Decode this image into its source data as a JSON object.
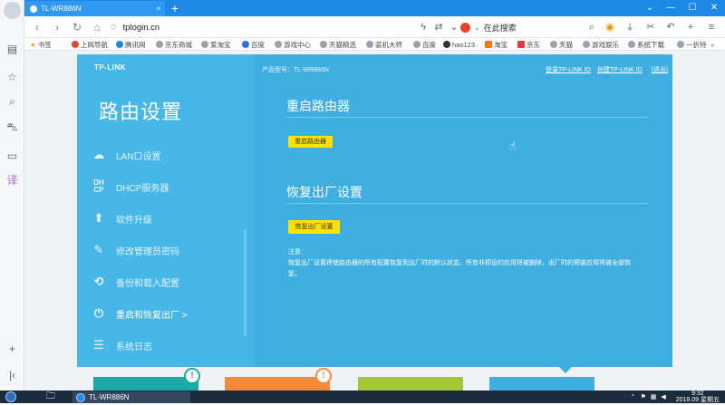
{
  "browser": {
    "tab_title": "TL-WR886N",
    "tab_close": "×",
    "new_tab": "+",
    "url": "tplogin.cn",
    "search_placeholder": "在此搜索",
    "window_controls": [
      "⌄",
      "—",
      "☐",
      "✕"
    ]
  },
  "bookmarks": [
    "书签",
    "上网导航",
    "腾讯网",
    "京东商城",
    "爱淘宝",
    "百度",
    "游戏中心",
    "天猫精选",
    "装机大师",
    "百度",
    "hao123",
    "淘宝",
    "京东",
    "天猫",
    "游戏娱乐",
    "系统下载",
    "一折特"
  ],
  "router": {
    "logo": "TP-LINK",
    "side_title": "路由设置",
    "model_label": "产品型号：TL-WR886N",
    "link_login": "登录TP-LINK ID",
    "link_create": "创建TP-LINK ID",
    "link_exit": "[退出]",
    "menu": [
      {
        "icon": "lan",
        "label": "LAN口设置"
      },
      {
        "icon": "dhcp",
        "label": "DHCP服务器"
      },
      {
        "icon": "upgrade",
        "label": "软件升级"
      },
      {
        "icon": "pencil",
        "label": "修改管理员密码"
      },
      {
        "icon": "backup",
        "label": "备份和载入配置"
      },
      {
        "icon": "power",
        "label": "重启和恢复出厂 >"
      },
      {
        "icon": "log",
        "label": "系统日志"
      }
    ],
    "section_reboot": {
      "title": "重启路由器",
      "button": "重启路由器"
    },
    "section_reset": {
      "title": "恢复出厂设置",
      "button": "恢复出厂设置"
    },
    "note_label": "注意：",
    "note_text": "恢复出厂设置将使路由器的所有配置恢复到出厂时的默认状态，所有非预设的应用将被删除，出厂时的预装应用将被全部恢复。",
    "badge_left": "!",
    "badge_right": "!"
  },
  "taskbar": {
    "app_label": "TL-WR886N",
    "time": "9:32",
    "date": "2018.09 星期五"
  },
  "colors": {
    "router_bg": "#3fafe2",
    "sidebar_bg": "#47b7e8",
    "button_yellow": "#ffe100",
    "tab_bar": "#1e88e5",
    "card_teal": "#1aa9a6",
    "card_orange": "#f58a3a",
    "card_green": "#a4c639",
    "card_blue": "#3fafe2"
  }
}
